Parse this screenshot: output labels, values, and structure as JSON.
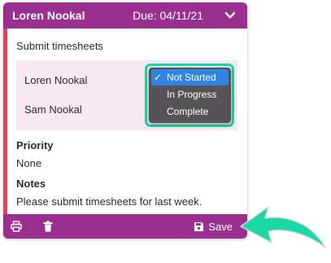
{
  "colors": {
    "header_bg": "#9b2f8f",
    "accent": "#e0435b",
    "panel_bg": "#f6e9f3",
    "dropdown_bg": "#575258",
    "selected_option": "#2e84e0",
    "highlight": "#19d8a6"
  },
  "card": {
    "header": {
      "name": "Loren Nookal",
      "due": "Due: 04/11/21",
      "toggle_icon": "chevron-down-icon"
    },
    "task_title": "Submit timesheets",
    "assignees": [
      {
        "name": "Loren Nookal"
      },
      {
        "name": "Sam Nookal"
      }
    ],
    "status_dropdown": {
      "selected": "Not Started",
      "check_mark": "✓",
      "options": [
        "Not Started",
        "In Progress",
        "Complete"
      ]
    },
    "priority": {
      "label": "Priority",
      "value": "None"
    },
    "notes": {
      "label": "Notes",
      "value": "Please submit timesheets for last week."
    },
    "footer": {
      "print_icon": "print-icon",
      "trash_icon": "trash-icon",
      "save_icon": "save-icon",
      "save_label": "Save"
    }
  }
}
